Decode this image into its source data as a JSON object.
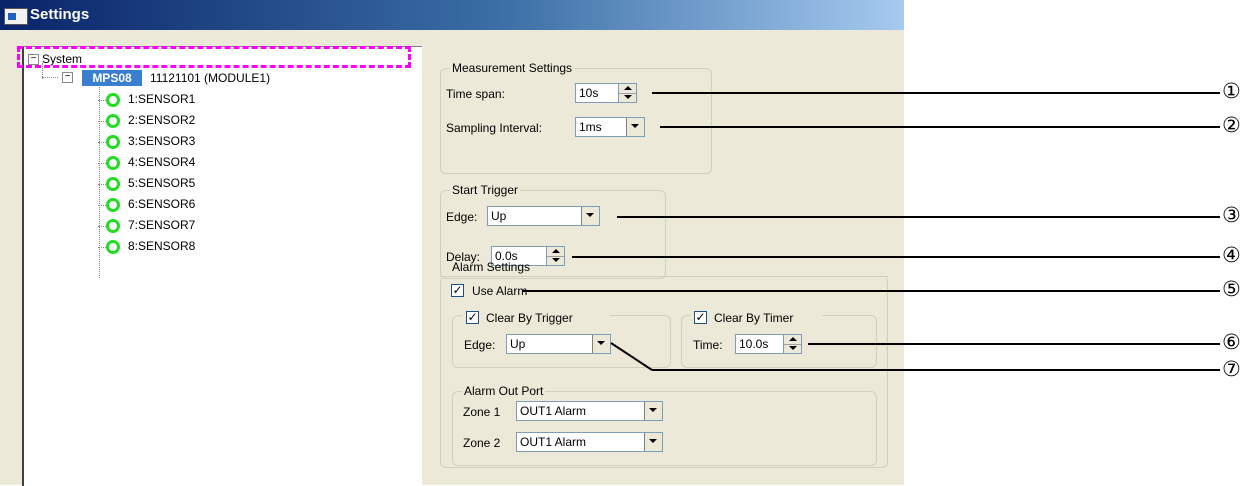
{
  "window": {
    "title": "Settings"
  },
  "tree": {
    "root": "System",
    "module_badge": "MPS08",
    "module_label": "11121101 (MODULE1)",
    "sensors": [
      "1:SENSOR1",
      "2:SENSOR2",
      "3:SENSOR3",
      "4:SENSOR4",
      "5:SENSOR5",
      "6:SENSOR6",
      "7:SENSOR7",
      "8:SENSOR8"
    ],
    "expander_symbol": "−"
  },
  "measurement": {
    "legend": "Measurement Settings",
    "time_span_label": "Time span:",
    "time_span_value": "10s",
    "sampling_label": "Sampling Interval:",
    "sampling_value": "1ms"
  },
  "start_trigger": {
    "legend": "Start Trigger",
    "edge_label": "Edge:",
    "edge_value": "Up",
    "delay_label": "Delay:",
    "delay_value": "0.0s"
  },
  "alarm": {
    "legend": "Alarm Settings",
    "use_alarm_label": "Use Alarm",
    "use_alarm_checked": true,
    "clear_by_trigger_label": "Clear By Trigger",
    "clear_by_trigger_checked": true,
    "trigger_edge_label": "Edge:",
    "trigger_edge_value": "Up",
    "clear_by_timer_label": "Clear By Timer",
    "clear_by_timer_checked": true,
    "time_label": "Time:",
    "time_value": "10.0s",
    "out_port_legend": "Alarm Out Port",
    "zone1_label": "Zone 1",
    "zone1_value": "OUT1 Alarm",
    "zone2_label": "Zone 2",
    "zone2_value": "OUT1 Alarm"
  },
  "checkmark": "✓",
  "callouts": [
    "①",
    "②",
    "③",
    "④",
    "⑤",
    "⑥",
    "⑦"
  ],
  "colors": {
    "highlight": "#ff00ff",
    "sensor_ok": "#22dd22",
    "badge": "#3a7ecf"
  }
}
